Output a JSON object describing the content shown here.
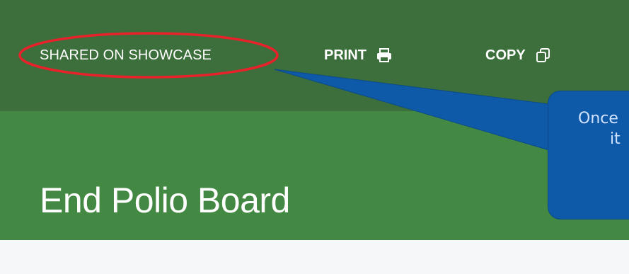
{
  "toolbar": {
    "shared_label": "SHARED ON SHOWCASE",
    "print_label": "PRINT",
    "copy_label": "COPY",
    "print_icon": "printer-icon",
    "copy_icon": "copy-icon"
  },
  "page": {
    "title": "End Polio Board"
  },
  "annotation": {
    "callout_line1": "Once",
    "callout_line2": "it",
    "ellipse_color": "#e8212b",
    "callout_color": "#0f5aa8"
  },
  "colors": {
    "toolbar_bg": "#3c6f3b",
    "banner_bg": "#438843",
    "content_bg": "#f6f7f9"
  }
}
